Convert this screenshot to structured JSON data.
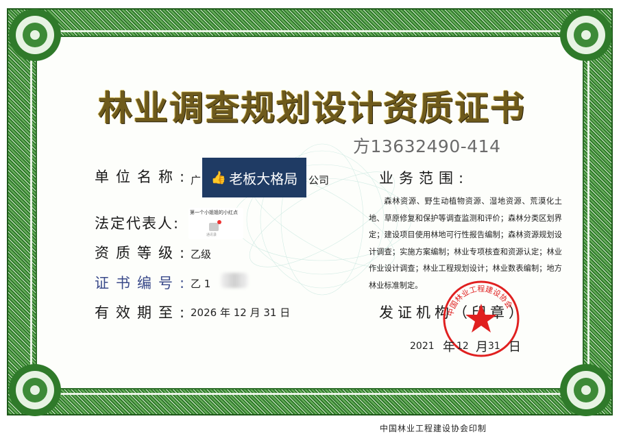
{
  "title": "林业调查规划设计资质证书",
  "watermark_phone": "方13632490-414",
  "fields": {
    "unit_name_label": "单位名称:",
    "unit_name_prefix": "广",
    "unit_name_suffix": "公司",
    "legal_rep_label": "法定代表人:",
    "grade_label": "资质等级:",
    "grade_value": "乙级",
    "cert_no_label": "证书编号:",
    "cert_no_value": "乙 1",
    "validity_label": "有效期至:",
    "validity_value": "2026 年 12 月 31 日"
  },
  "overlay_badge": {
    "icon": "thumbs-up-icon",
    "text": "老板大格局"
  },
  "miniapp_popup": {
    "title": "第一个小姐姐的小红点",
    "badge_count": "1",
    "sub": "通讯录"
  },
  "scope": {
    "label": "业务范围:",
    "text": "森林资源、野生动植物资源、湿地资源、荒漠化土地、草原修复和保护等调查监测和评价；森林分类区划界定；建设项目使用林地可行性报告编制；森林资源规划设计调查；实施方案编制；林业专项核查和资源认定；林业作业设计调查；林业工程规划设计；林业数表编制；地方林业标准制定。"
  },
  "issuer": {
    "label": "发证机构（印章）",
    "year": "2021",
    "year_unit": "年",
    "month": "12",
    "month_unit": "月",
    "day": "31",
    "day_unit": "日",
    "seal_text": "中国林业工程建设协会"
  },
  "footer": "中国林业工程建设协会印制",
  "colors": {
    "border_green": "#2f7a2a",
    "title_gold": "#6e5a1c",
    "seal_red": "#e02020",
    "badge_navy": "#1f3b64"
  }
}
